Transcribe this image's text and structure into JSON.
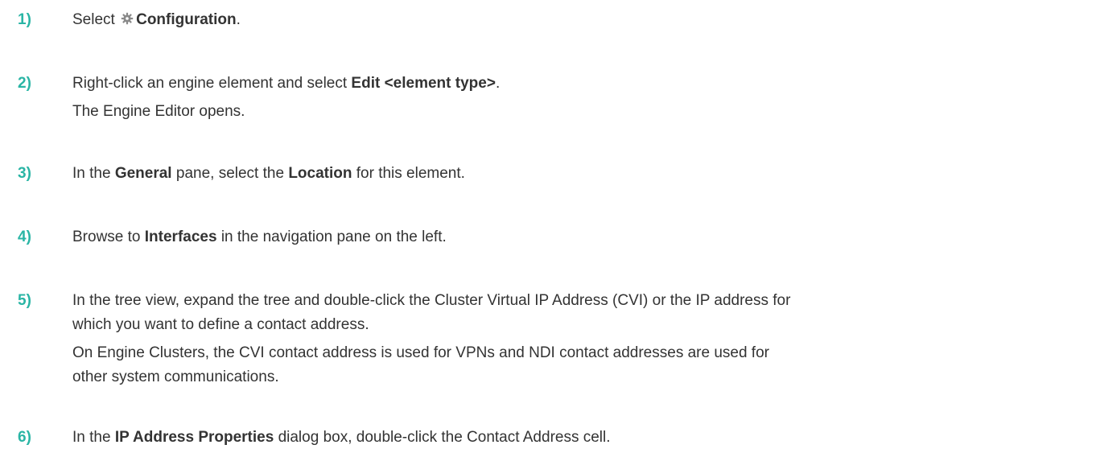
{
  "steps": [
    {
      "number": "1)",
      "pre": "Select ",
      "icon": "gear-icon",
      "bold": "Configuration",
      "post": "."
    },
    {
      "number": "2)",
      "pre": "Right-click an engine element and select ",
      "bold": "Edit <element type>",
      "post": ".",
      "sub": "The Engine Editor opens."
    },
    {
      "number": "3)",
      "pre": "In the ",
      "bold1": "General",
      "mid": " pane, select the ",
      "bold2": "Location",
      "post": " for this element."
    },
    {
      "number": "4)",
      "pre": "Browse to ",
      "bold": "Interfaces",
      "post": " in the navigation pane on the left."
    },
    {
      "number": "5)",
      "line1": "In the tree view, expand the tree and double-click the Cluster Virtual IP Address (CVI) or the IP address for",
      "line2": "which you want to define a contact address.",
      "sub1": "On Engine Clusters, the CVI contact address is used for VPNs and NDI contact addresses are used for",
      "sub2": "other system communications."
    },
    {
      "number": "6)",
      "pre": "In the ",
      "bold": "IP Address Properties",
      "post": " dialog box, double-click the Contact Address cell."
    }
  ]
}
